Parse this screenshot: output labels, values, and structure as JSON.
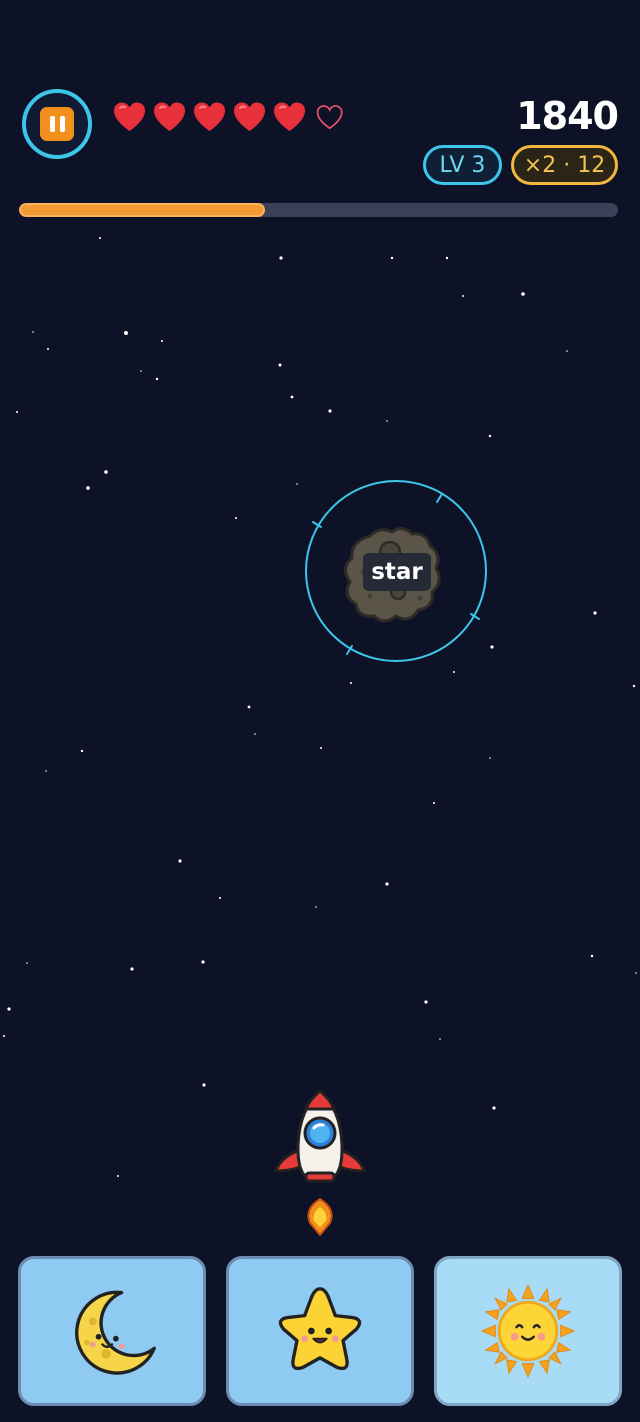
{
  "hud": {
    "pause_icon": "pause-icon",
    "lives_total": 6,
    "lives_remaining": 5,
    "score": "1840",
    "level": "LV 3",
    "combo": "×2 · 12",
    "progress_fraction": 0.41,
    "colors": {
      "accent_cyan": "#3cc6ea",
      "accent_orange": "#f39a35",
      "accent_gold": "#f1b73e",
      "heart_red": "#e8313a"
    }
  },
  "target": {
    "word": "star",
    "object": "asteroid-icon"
  },
  "player": {
    "object": "rocket-icon"
  },
  "answers": [
    {
      "icon": "moon-icon"
    },
    {
      "icon": "star-icon"
    },
    {
      "icon": "sun-icon"
    }
  ]
}
